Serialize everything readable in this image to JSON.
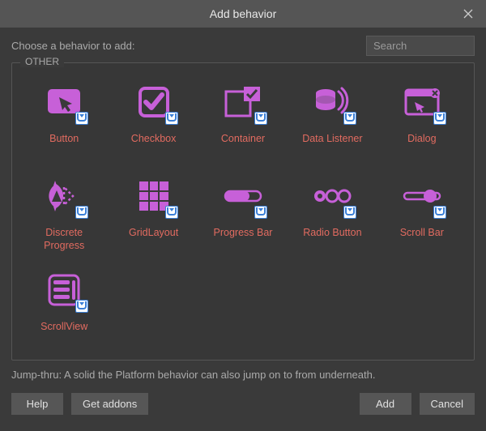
{
  "dialog": {
    "title": "Add behavior",
    "prompt": "Choose a behavior to add:",
    "search_placeholder": "Search",
    "section_label": "OTHER",
    "description": "Jump-thru: A solid the Platform behavior can also jump on to from underneath."
  },
  "items": [
    {
      "id": "button",
      "label": "Button"
    },
    {
      "id": "checkbox",
      "label": "Checkbox"
    },
    {
      "id": "container",
      "label": "Container"
    },
    {
      "id": "data-listener",
      "label": "Data Listener"
    },
    {
      "id": "dialog",
      "label": "Dialog"
    },
    {
      "id": "discrete-progress",
      "label": "Discrete Progress"
    },
    {
      "id": "grid-layout",
      "label": "GridLayout"
    },
    {
      "id": "progress-bar",
      "label": "Progress Bar"
    },
    {
      "id": "radio-button",
      "label": "Radio Button"
    },
    {
      "id": "scroll-bar",
      "label": "Scroll Bar"
    },
    {
      "id": "scroll-view",
      "label": "ScrollView"
    }
  ],
  "buttons": {
    "help": "Help",
    "get_addons": "Get addons",
    "add": "Add",
    "cancel": "Cancel"
  }
}
